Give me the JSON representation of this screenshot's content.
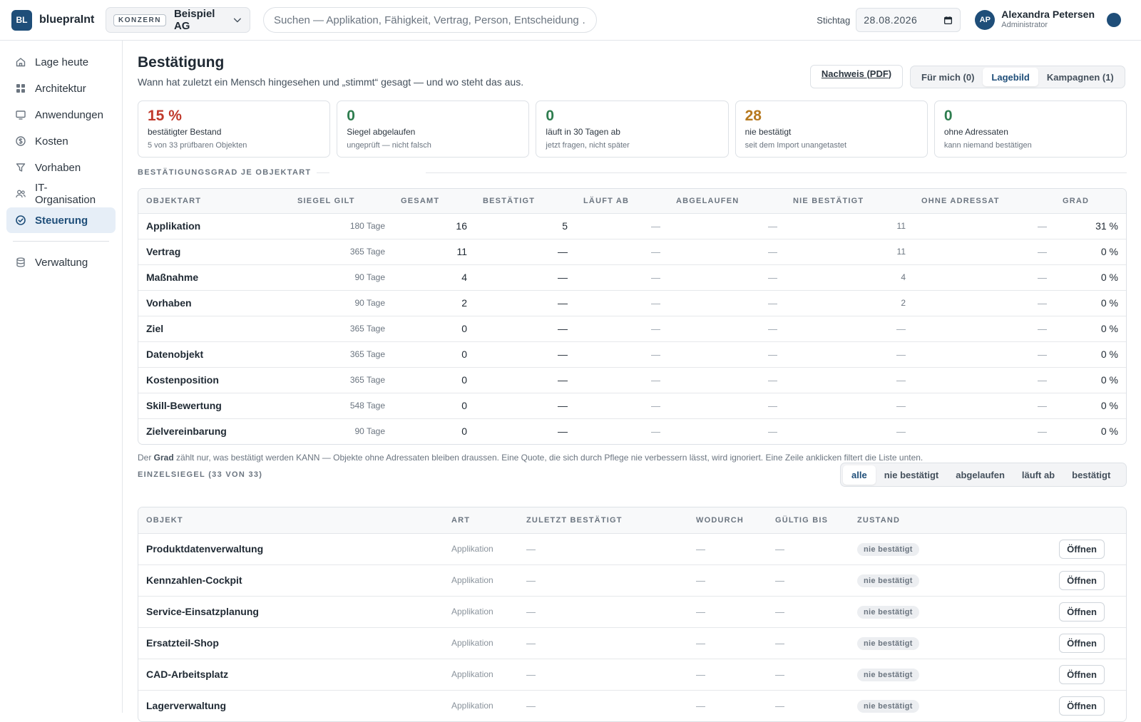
{
  "app": {
    "logo": "BL",
    "name": "bluepraInt"
  },
  "tenant": {
    "badge": "KONZERN",
    "name": "Beispiel AG"
  },
  "search": {
    "placeholder": "Suchen — Applikation, Fähigkeit, Vertrag, Person, Entscheidung …"
  },
  "stichtag": {
    "label": "Stichtag",
    "value": "28.08.2026"
  },
  "user": {
    "initials": "AP",
    "name": "Alexandra Petersen",
    "role": "Administrator"
  },
  "colors": {
    "accent": "#1f4e79",
    "red": "#c0392b",
    "green": "#2e7d4f",
    "amber": "#b7791f"
  },
  "sidebar": {
    "items": [
      {
        "label": "Lage heute",
        "icon": "home-icon"
      },
      {
        "label": "Architektur",
        "icon": "grid-icon"
      },
      {
        "label": "Anwendungen",
        "icon": "monitor-icon"
      },
      {
        "label": "Kosten",
        "icon": "dollar-icon"
      },
      {
        "label": "Vorhaben",
        "icon": "filter-icon"
      },
      {
        "label": "IT-Organisation",
        "icon": "users-icon"
      },
      {
        "label": "Steuerung",
        "icon": "check-circle-icon",
        "active": true
      },
      {
        "label": "Verwaltung",
        "icon": "database-icon"
      }
    ]
  },
  "page": {
    "title": "Bestätigung",
    "subtitle": "Wann hat zuletzt ein Mensch hingesehen und „stimmt“ gesagt — und wo steht das aus.",
    "pdf_button": "Nachweis (PDF)",
    "views": [
      "Für mich (0)",
      "Lagebild",
      "Kampagnen (1)"
    ],
    "active_view": "Lagebild"
  },
  "kpis": [
    {
      "value": "15 %",
      "label": "bestätigter Bestand",
      "note": "5 von 33 prüfbaren Objekten",
      "color": "#c0392b"
    },
    {
      "value": "0",
      "label": "Siegel abgelaufen",
      "note": "ungeprüft — nicht falsch",
      "color": "#2e7d4f"
    },
    {
      "value": "0",
      "label": "läuft in 30 Tagen ab",
      "note": "jetzt fragen, nicht später",
      "color": "#2e7d4f"
    },
    {
      "value": "28",
      "label": "nie bestätigt",
      "note": "seit dem Import unangetastet",
      "color": "#b7791f"
    },
    {
      "value": "0",
      "label": "ohne Adressaten",
      "note": "kann niemand bestätigen",
      "color": "#2e7d4f"
    }
  ],
  "grade_section": {
    "label": "BESTÄTIGUNGSGRAD JE OBJEKTART",
    "columns": [
      "OBJEKTART",
      "SIEGEL GILT",
      "GESAMT",
      "BESTÄTIGT",
      "LÄUFT AB",
      "ABGELAUFEN",
      "NIE BESTÄTIGT",
      "OHNE ADRESSAT",
      "GRAD"
    ],
    "rows": [
      {
        "type": "Applikation",
        "validity": "180 Tage",
        "total": "16",
        "confirmed": "5",
        "expiring": "—",
        "expired": "—",
        "never": "11",
        "no_addressee": "—",
        "grade": "31 %"
      },
      {
        "type": "Vertrag",
        "validity": "365 Tage",
        "total": "11",
        "confirmed": "—",
        "expiring": "—",
        "expired": "—",
        "never": "11",
        "no_addressee": "—",
        "grade": "0 %"
      },
      {
        "type": "Maßnahme",
        "validity": "90 Tage",
        "total": "4",
        "confirmed": "—",
        "expiring": "—",
        "expired": "—",
        "never": "4",
        "no_addressee": "—",
        "grade": "0 %"
      },
      {
        "type": "Vorhaben",
        "validity": "90 Tage",
        "total": "2",
        "confirmed": "—",
        "expiring": "—",
        "expired": "—",
        "never": "2",
        "no_addressee": "—",
        "grade": "0 %"
      },
      {
        "type": "Ziel",
        "validity": "365 Tage",
        "total": "0",
        "confirmed": "—",
        "expiring": "—",
        "expired": "—",
        "never": "—",
        "no_addressee": "—",
        "grade": "0 %"
      },
      {
        "type": "Datenobjekt",
        "validity": "365 Tage",
        "total": "0",
        "confirmed": "—",
        "expiring": "—",
        "expired": "—",
        "never": "—",
        "no_addressee": "—",
        "grade": "0 %"
      },
      {
        "type": "Kostenposition",
        "validity": "365 Tage",
        "total": "0",
        "confirmed": "—",
        "expiring": "—",
        "expired": "—",
        "never": "—",
        "no_addressee": "—",
        "grade": "0 %"
      },
      {
        "type": "Skill-Bewertung",
        "validity": "548 Tage",
        "total": "0",
        "confirmed": "—",
        "expiring": "—",
        "expired": "—",
        "never": "—",
        "no_addressee": "—",
        "grade": "0 %"
      },
      {
        "type": "Zielvereinbarung",
        "validity": "90 Tage",
        "total": "0",
        "confirmed": "—",
        "expiring": "—",
        "expired": "—",
        "never": "—",
        "no_addressee": "—",
        "grade": "0 %"
      }
    ],
    "footnote_bold": "Grad",
    "footnote_pre": "Der ",
    "footnote_post": " zählt nur, was bestätigt werden KANN — Objekte ohne Adressaten bleiben draussen. Eine Quote, die sich durch Pflege nie verbessern lässt, wird ignoriert. Eine Zeile anklicken filtert die Liste unten."
  },
  "seals_section": {
    "label": "EINZELSIEGEL (33 VON 33)",
    "filters": [
      "alle",
      "nie bestätigt",
      "abgelaufen",
      "läuft ab",
      "bestätigt"
    ],
    "active_filter": "alle",
    "columns": [
      "OBJEKT",
      "ART",
      "ZULETZT BESTÄTIGT",
      "WODURCH",
      "GÜLTIG BIS",
      "ZUSTAND"
    ],
    "open_label": "Öffnen",
    "rows": [
      {
        "object": "Produktdatenverwaltung",
        "kind": "Applikation",
        "last": "—",
        "via": "—",
        "valid": "—",
        "state": "nie bestätigt"
      },
      {
        "object": "Kennzahlen-Cockpit",
        "kind": "Applikation",
        "last": "—",
        "via": "—",
        "valid": "—",
        "state": "nie bestätigt"
      },
      {
        "object": "Service-Einsatzplanung",
        "kind": "Applikation",
        "last": "—",
        "via": "—",
        "valid": "—",
        "state": "nie bestätigt"
      },
      {
        "object": "Ersatzteil-Shop",
        "kind": "Applikation",
        "last": "—",
        "via": "—",
        "valid": "—",
        "state": "nie bestätigt"
      },
      {
        "object": "CAD-Arbeitsplatz",
        "kind": "Applikation",
        "last": "—",
        "via": "—",
        "valid": "—",
        "state": "nie bestätigt"
      },
      {
        "object": "Lagerverwaltung",
        "kind": "Applikation",
        "last": "—",
        "via": "—",
        "valid": "—",
        "state": "nie bestätigt"
      }
    ]
  }
}
